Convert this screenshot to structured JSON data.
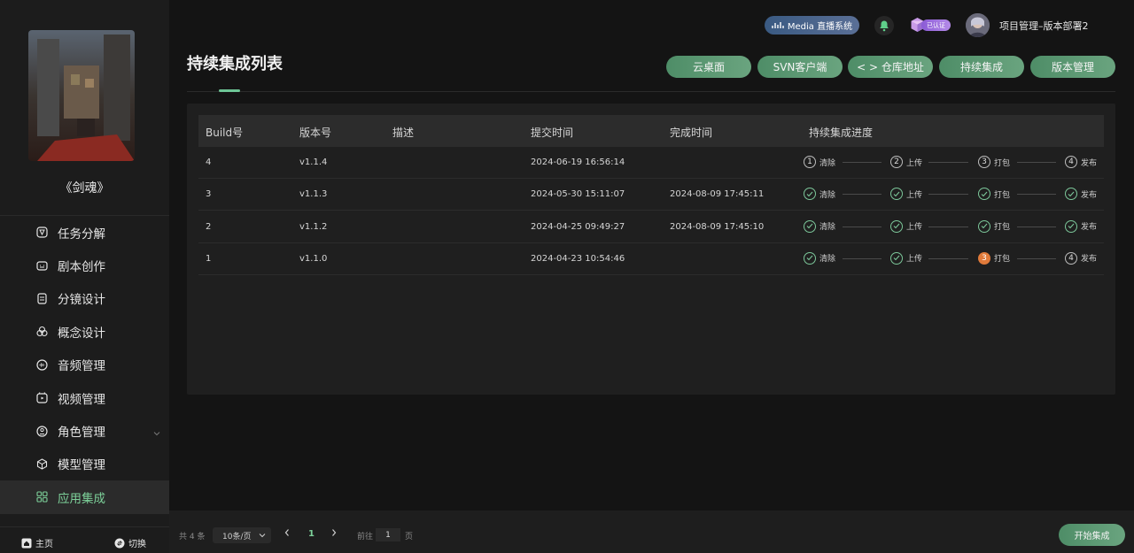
{
  "sidebar": {
    "project_name": "《剑魂》",
    "items": [
      {
        "label": "任务分解",
        "icon": "task-icon"
      },
      {
        "label": "剧本创作",
        "icon": "script-icon"
      },
      {
        "label": "分镜设计",
        "icon": "storyboard-icon"
      },
      {
        "label": "概念设计",
        "icon": "concept-icon"
      },
      {
        "label": "音频管理",
        "icon": "audio-icon"
      },
      {
        "label": "视频管理",
        "icon": "video-icon"
      },
      {
        "label": "角色管理",
        "icon": "character-icon"
      },
      {
        "label": "模型管理",
        "icon": "model-icon"
      },
      {
        "label": "应用集成",
        "icon": "apps-icon"
      }
    ],
    "home_label": "主页",
    "switch_label": "切换"
  },
  "header": {
    "media_label": "Media 直播系统",
    "cert_label": "已认证",
    "user_name": "项目管理–版本部署2"
  },
  "page": {
    "title": "持续集成列表",
    "buttons": [
      "云桌面",
      "SVN客户端",
      "< > 仓库地址",
      "持续集成",
      "版本管理"
    ]
  },
  "table": {
    "columns": [
      "Build号",
      "版本号",
      "描述",
      "提交时间",
      "完成时间",
      "持续集成进度"
    ],
    "steps": [
      "清除",
      "上传",
      "打包",
      "发布"
    ],
    "rows": [
      {
        "build": "4",
        "version": "v1.1.4",
        "desc": "",
        "submit": "2024-06-19 16:56:14",
        "finish": "",
        "status": [
          "pending",
          "pending",
          "pending",
          "pending"
        ]
      },
      {
        "build": "3",
        "version": "v1.1.3",
        "desc": "",
        "submit": "2024-05-30 15:11:07",
        "finish": "2024-08-09 17:45:11",
        "status": [
          "done",
          "done",
          "done",
          "done"
        ]
      },
      {
        "build": "2",
        "version": "v1.1.2",
        "desc": "",
        "submit": "2024-04-25 09:49:27",
        "finish": "2024-08-09 17:45:10",
        "status": [
          "done",
          "done",
          "done",
          "done"
        ]
      },
      {
        "build": "1",
        "version": "v1.1.0",
        "desc": "",
        "submit": "2024-04-23 10:54:46",
        "finish": "",
        "status": [
          "done",
          "done",
          "active",
          "pending"
        ]
      }
    ]
  },
  "pagination": {
    "total": "共 4 条",
    "page_size": "10条/页",
    "current": "1",
    "goto_label": "前往",
    "goto_value": "1",
    "unit": "页"
  },
  "actions": {
    "start_label": "开始集成"
  },
  "colors": {
    "accent": "#7dd19a",
    "button": "#5c9a73",
    "active_step": "#e07a3a"
  }
}
